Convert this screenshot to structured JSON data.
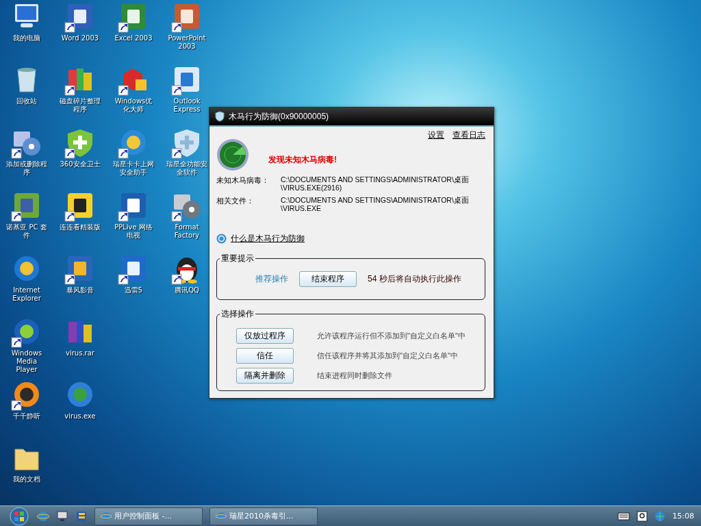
{
  "desktop": {
    "icons": [
      {
        "label": "我的电脑",
        "kind": "computer",
        "shortcut": false
      },
      {
        "label": "回收站",
        "kind": "bin",
        "shortcut": false
      },
      {
        "label": "添加或删除程序",
        "kind": "installer",
        "shortcut": true
      },
      {
        "label": "诺基亚 PC 套件",
        "kind": "suite",
        "shortcut": true
      },
      {
        "label": "Internet Explorer",
        "kind": "browser",
        "shortcut": false
      },
      {
        "label": "Windows Media Player",
        "kind": "player",
        "shortcut": true
      },
      {
        "label": "千千静听",
        "kind": "headphones",
        "shortcut": true
      },
      {
        "label": "我的文档",
        "kind": "folder",
        "shortcut": false
      },
      {
        "label": "Word 2003",
        "kind": "word",
        "shortcut": true
      },
      {
        "label": "磁盘碎片整理程序",
        "kind": "blocks",
        "shortcut": true
      },
      {
        "label": "360安全卫士",
        "kind": "shield",
        "shortcut": true
      },
      {
        "label": "连连看精装版",
        "kind": "game",
        "shortcut": true
      },
      {
        "label": "暴风影音",
        "kind": "film",
        "shortcut": true
      },
      {
        "label": "virus.rar",
        "kind": "archive",
        "shortcut": false
      },
      {
        "label": "virus.exe",
        "kind": "globe",
        "shortcut": false
      },
      {
        "label": "Excel 2003",
        "kind": "excel",
        "shortcut": true
      },
      {
        "label": "Windows优化大师",
        "kind": "cube",
        "shortcut": true
      },
      {
        "label": "瑞星卡卡上网安全助手",
        "kind": "mascot",
        "shortcut": true
      },
      {
        "label": "PPLive 网络电视",
        "kind": "tv",
        "shortcut": true
      },
      {
        "label": "迅雷5",
        "kind": "feather",
        "shortcut": true
      },
      {
        "label": "PowerPoint 2003",
        "kind": "powerpoint",
        "shortcut": true
      },
      {
        "label": "Outlook Express",
        "kind": "mail",
        "shortcut": true
      },
      {
        "label": "瑞星全功能安全软件",
        "kind": "lion",
        "shortcut": true
      },
      {
        "label": "Format Factory",
        "kind": "factory",
        "shortcut": true
      },
      {
        "label": "腾讯QQ",
        "kind": "penguin",
        "shortcut": true
      }
    ]
  },
  "dialog": {
    "title": "木马行为防御(0x90000005)",
    "links": [
      "设置",
      "查看日志"
    ],
    "alert": "发现未知木马病毒!",
    "details": [
      {
        "label": "未知木马病毒：",
        "value": "C:\\DOCUMENTS AND SETTINGS\\ADMINISTRATOR\\桌面\\VIRUS.EXE(2916)"
      },
      {
        "label": "相关文件：",
        "value": "C:\\DOCUMENTS AND SETTINGS\\ADMINISTRATOR\\桌面\\VIRUS.EXE"
      }
    ],
    "help_link": "什么是木马行为防御",
    "important": {
      "legend": "重要提示",
      "label": "推荐操作",
      "button": "结束程序",
      "countdown": "54 秒后将自动执行此操作"
    },
    "choices": {
      "legend": "选择操作",
      "options": [
        {
          "button": "仅放过程序",
          "description": "允许该程序运行但不添加到\"自定义白名单\"中"
        },
        {
          "button": "信任",
          "description": "信任该程序并将其添加到\"自定义白名单\"中"
        },
        {
          "button": "隔离并删除",
          "description": "结束进程同时删除文件"
        }
      ]
    }
  },
  "taskbar": {
    "tasks": [
      {
        "label": "用户控制面板 -...",
        "selected": false
      },
      {
        "label": "瑞星2010杀毒引...",
        "selected": false
      }
    ],
    "clock": "15:08"
  }
}
